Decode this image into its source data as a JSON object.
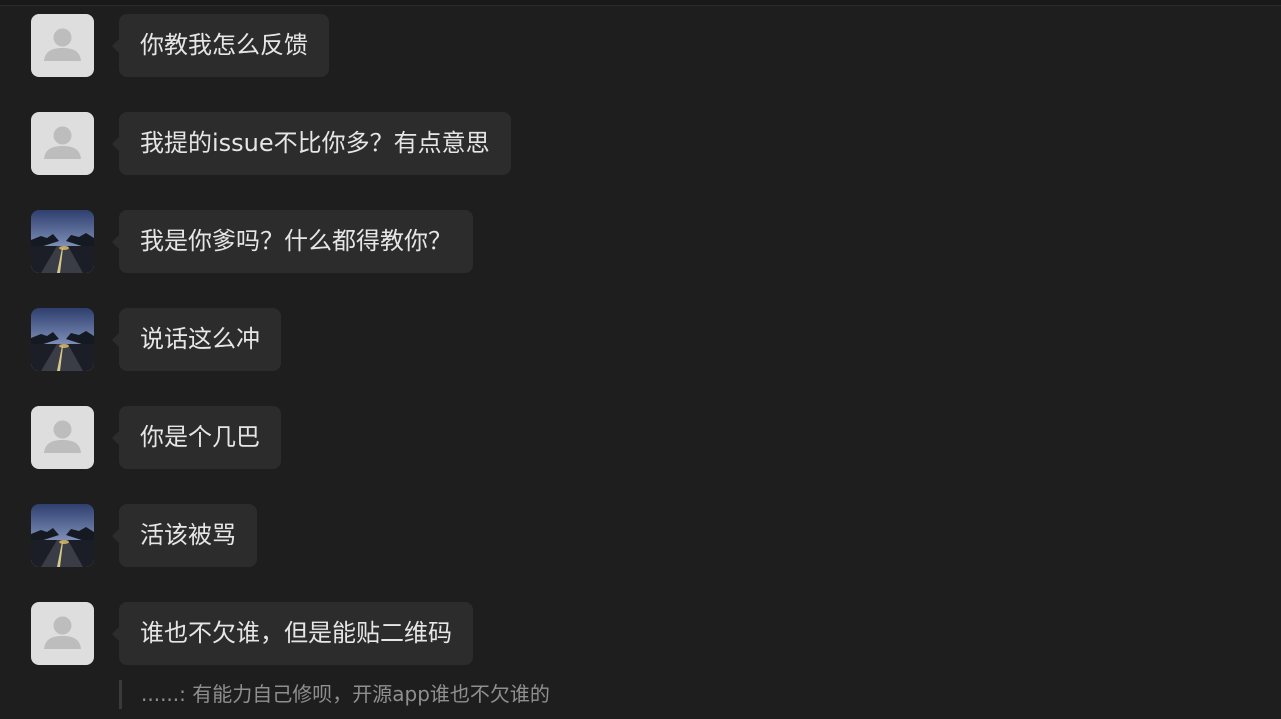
{
  "messages": [
    {
      "avatar": "default",
      "text": "你教我怎么反馈"
    },
    {
      "avatar": "default",
      "text": "我提的issue不比你多？有点意思"
    },
    {
      "avatar": "photo",
      "text": "我是你爹吗？什么都得教你？"
    },
    {
      "avatar": "photo",
      "text": "说话这么冲"
    },
    {
      "avatar": "default",
      "text": "你是个几巴"
    },
    {
      "avatar": "photo",
      "text": "活该被骂"
    },
    {
      "avatar": "default",
      "text": "谁也不欠谁，但是能贴二维码"
    }
  ],
  "quote": {
    "text": "......: 有能力自己修呗，开源app谁也不欠谁的"
  },
  "icons": {
    "default_avatar": "person-silhouette-icon",
    "photo_avatar": "road-at-dusk-photo"
  },
  "colors": {
    "background": "#1e1e1e",
    "bubble": "#2c2c2c",
    "text": "#e6e6e6",
    "quote_text": "#8f8f8f",
    "default_avatar_bg": "#dedede"
  }
}
